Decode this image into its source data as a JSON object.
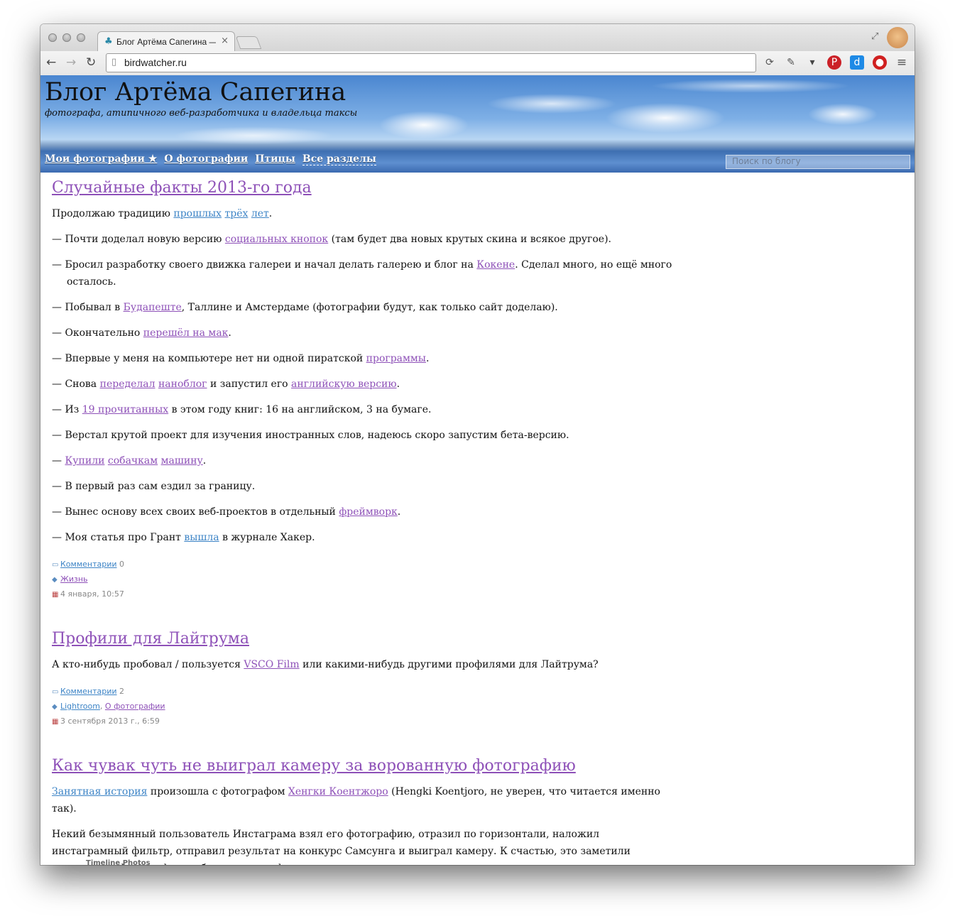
{
  "browser": {
    "tab_title": "Блог Артёма Сапегина —",
    "url": "birdwatcher.ru"
  },
  "blog": {
    "title": "Блог Артёма Сапегина",
    "subtitle": "фотографа, атипичного веб-разработчика и владельца таксы",
    "nav": [
      "Мои фотографии ★",
      "О фотографии",
      "Птицы",
      "Все разделы"
    ],
    "search_placeholder": "Поиск по блогу"
  },
  "posts": [
    {
      "title": "Случайные факты 2013-го года",
      "intro": {
        "t0": "Продолжаю традицию ",
        "l1": "прошлых",
        "l2": "трёх",
        "l3": "лет",
        "t1": "."
      },
      "items": [
        {
          "t0": "— Почти доделал новую версию ",
          "l1": "социальных кнопок",
          "t1": " (там будет два новых крутых скина и всякое другое)."
        },
        {
          "t0": "— Бросил разработку своего движка галереи и начал делать галерею и блог на ",
          "l1": "Кокене",
          "t1": ". Сделал много, но ещё много осталось."
        },
        {
          "t0": "— Побывал в ",
          "l1": "Будапеште",
          "t1": ", Таллине и Амстердаме (фотографии будут, как только сайт доделаю)."
        },
        {
          "t0": "— Окончательно ",
          "l1": "перешёл на мак",
          "t1": "."
        },
        {
          "t0": "— Впервые у меня на компьютере нет ни одной пиратской ",
          "l1": "программы",
          "t1": "."
        },
        {
          "t0": "— Снова ",
          "l1": "переделал",
          "l2": "наноблог",
          "t1": " и запустил его ",
          "l3": "английскую версию",
          "t2": "."
        },
        {
          "t0": "— Из ",
          "l1": "19 прочитанных",
          "t1": " в этом году книг: 16 на английском, 3 на бумаге."
        },
        {
          "t0": "— Верстал крутой проект для изучения иностранных слов, надеюсь скоро запустим бета-версию."
        },
        {
          "t0": "— ",
          "l1": "Купили",
          "l2": "собачкам",
          "l3": "машину",
          "t1": "."
        },
        {
          "t0": "— В первый раз сам ездил за границу."
        },
        {
          "t0": "— Вынес основу всех своих веб-проектов в отдельный ",
          "l1": "фреймворк",
          "t1": "."
        },
        {
          "t0": "— Моя статья про Грант ",
          "l1": "вышла",
          "t1": " в журнале Хакер."
        }
      ],
      "meta": {
        "comments_label": "Комментарии",
        "comments_count": "0",
        "tags": [
          "Жизнь"
        ],
        "date": "4 января, 10:57"
      }
    },
    {
      "title": "Профили для Лайтрума",
      "body": {
        "t0": "А кто-нибудь пробовал / пользуется ",
        "l1": "VSCO Film",
        "t1": " или какими-нибудь другими профилями для Лайтрума?"
      },
      "meta": {
        "comments_label": "Комментарии",
        "comments_count": "2",
        "tags": [
          "Lightroom",
          "О фотографии"
        ],
        "date": "3 сентября 2013 г., 6:59"
      }
    },
    {
      "title": "Как чувак чуть не выиграл камеру за ворованную фотографию",
      "p1": {
        "l1": "Занятная история",
        "t0": " произошла с фотографом ",
        "l2": "Хенгки Коентжоро",
        "t1": " (Hengki Koentjoro, не уверен, что читается именно так)."
      },
      "p2": "Некий безымянный пользователь Инстаграма взял его фотографию, отразил по горизонтали, наложил инстаграмный фильтр, отправил результат на конкурс Самсунга и выиграл камеру. К счастью, это заметили поклонники фотографа и работу дисквалифицировали, а приз отправлять не стали."
    }
  ],
  "embed_label": "Timeline Photos"
}
